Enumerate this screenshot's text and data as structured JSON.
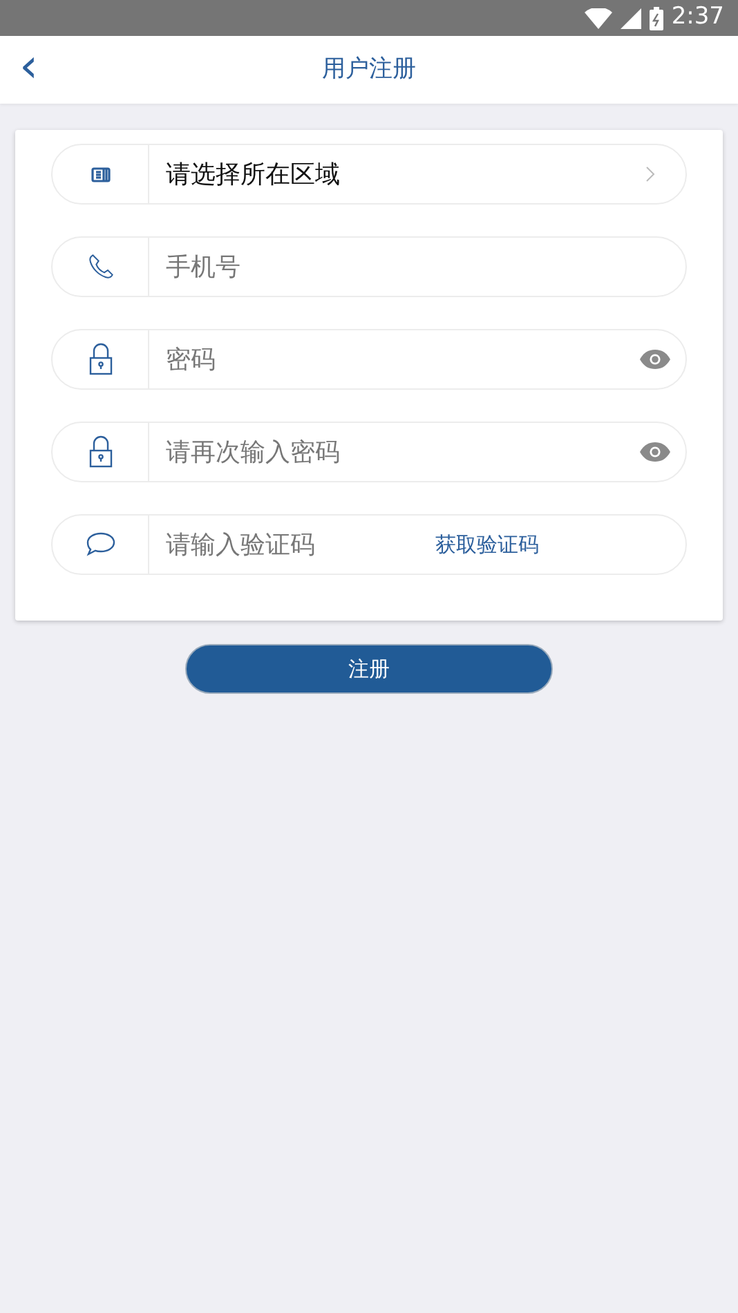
{
  "status_bar": {
    "time": "2:37"
  },
  "header": {
    "back": "‹",
    "title": "用户注册"
  },
  "form": {
    "fields": [
      {
        "kind": "region",
        "label": "请选择所在区域"
      },
      {
        "kind": "phone",
        "placeholder": "手机号"
      },
      {
        "kind": "password",
        "placeholder": "密码"
      },
      {
        "kind": "password",
        "placeholder": "请再次输入密码"
      },
      {
        "kind": "code",
        "placeholder": "请输入验证码",
        "action": "获取验证码"
      }
    ]
  },
  "submit": "注册"
}
